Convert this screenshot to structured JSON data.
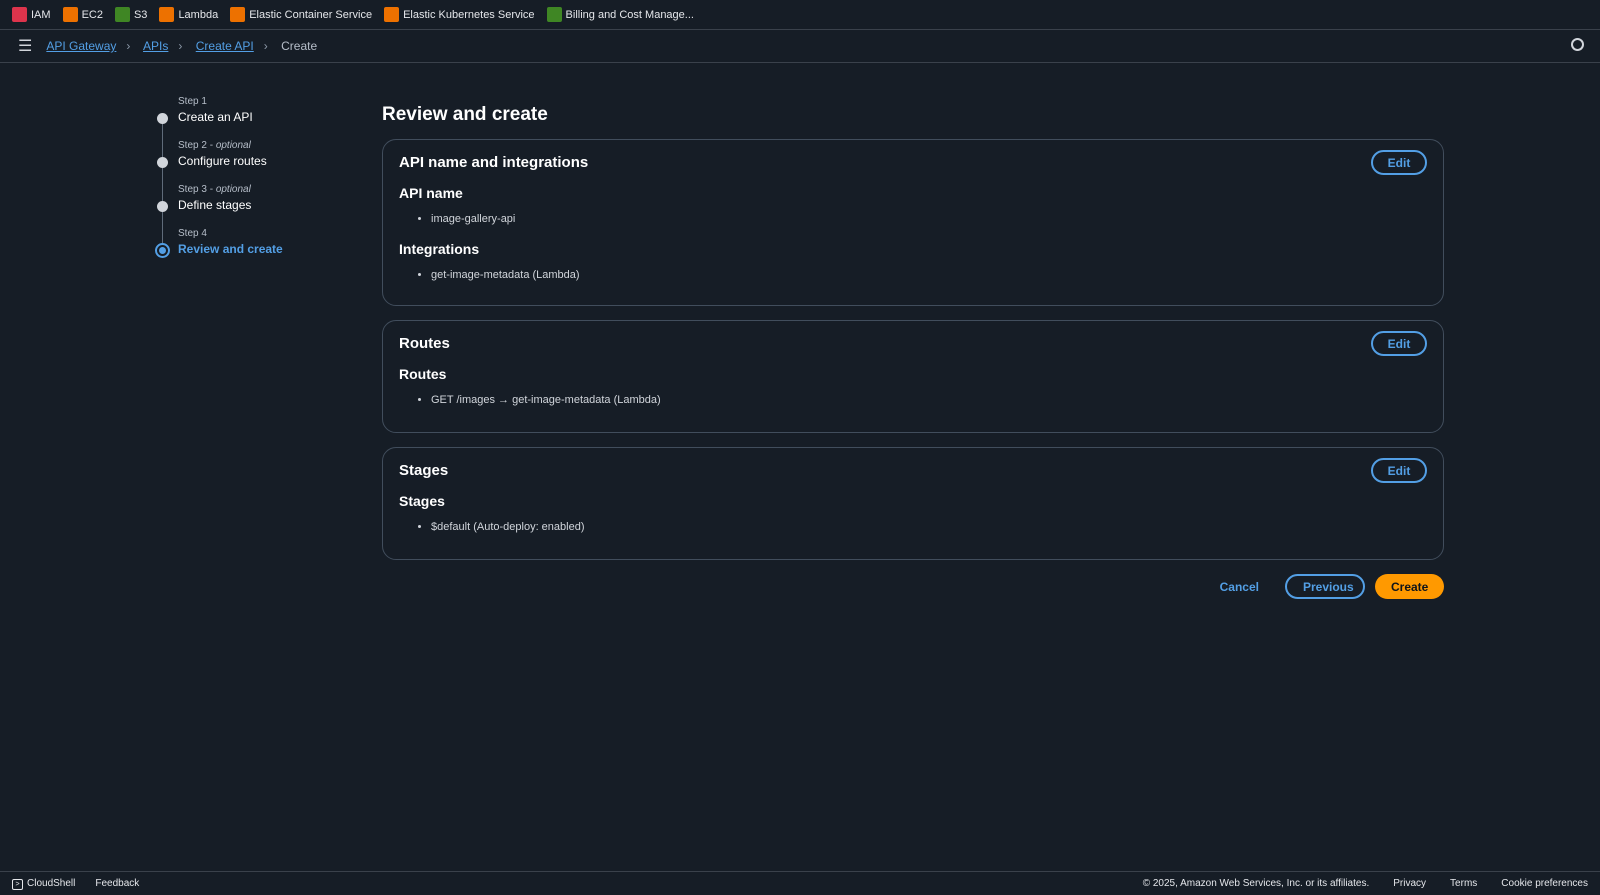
{
  "favorites": [
    {
      "label": "IAM",
      "color": "#dd344c"
    },
    {
      "label": "EC2",
      "color": "#ed7100"
    },
    {
      "label": "S3",
      "color": "#3f8624"
    },
    {
      "label": "Lambda",
      "color": "#ed7100"
    },
    {
      "label": "Elastic Container Service",
      "color": "#ed7100"
    },
    {
      "label": "Elastic Kubernetes Service",
      "color": "#ed7100"
    },
    {
      "label": "Billing and Cost Manage...",
      "color": "#3f8624"
    }
  ],
  "breadcrumb": [
    "API Gateway",
    "APIs",
    "Create API",
    "Create"
  ],
  "steps": [
    {
      "label": "Step 1",
      "optional": "",
      "name": "Create an API"
    },
    {
      "label": "Step 2 - ",
      "optional": "optional",
      "name": "Configure routes"
    },
    {
      "label": "Step 3 - ",
      "optional": "optional",
      "name": "Define stages"
    },
    {
      "label": "Step 4",
      "optional": "",
      "name": "Review and create"
    }
  ],
  "title": "Review and create",
  "cards": [
    {
      "title": "API name and integrations",
      "edit": "Edit",
      "sections": [
        {
          "heading": "API name",
          "items": [
            "image-gallery-api"
          ]
        },
        {
          "heading": "Integrations",
          "items": [
            "get-image-metadata (Lambda)"
          ]
        }
      ]
    },
    {
      "title": "Routes",
      "edit": "Edit",
      "sections": [
        {
          "heading": "Routes",
          "items": [
            "GET /images → get-image-metadata (Lambda)"
          ]
        }
      ]
    },
    {
      "title": "Stages",
      "edit": "Edit",
      "sections": [
        {
          "heading": "Stages",
          "items": [
            "$default (Auto-deploy: enabled)"
          ]
        }
      ]
    }
  ],
  "actions": {
    "cancel": "Cancel",
    "previous": "Previous",
    "create": "Create"
  },
  "footer": {
    "cloudshell": "CloudShell",
    "feedback": "Feedback",
    "copyright": "© 2025, Amazon Web Services, Inc. or its affiliates.",
    "privacy": "Privacy",
    "terms": "Terms",
    "cookies": "Cookie preferences"
  }
}
